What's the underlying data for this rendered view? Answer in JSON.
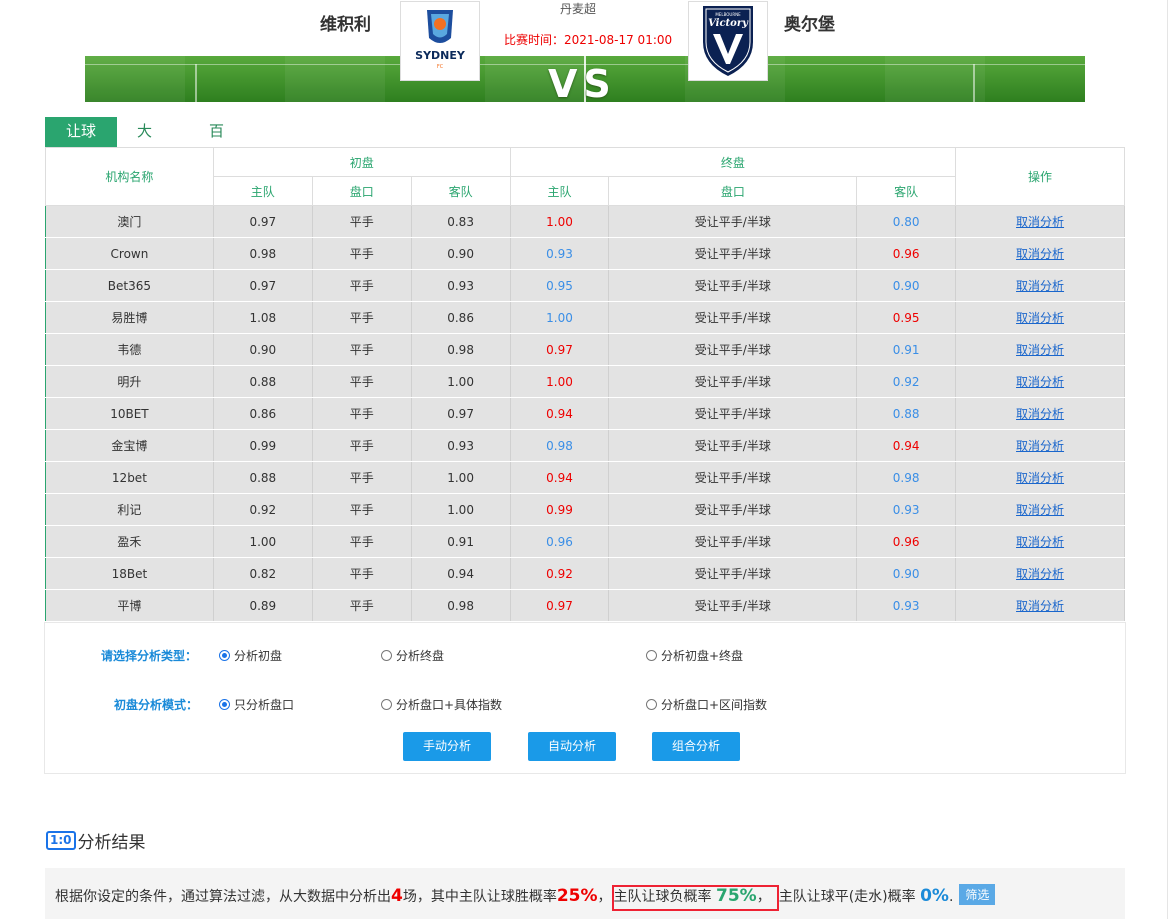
{
  "header": {
    "home_team": "维积利",
    "away_team": "奥尔堡",
    "league": "丹麦超",
    "match_time": "比赛时间：2021-08-17 01:00",
    "vs": "VS",
    "home_logo_text": "SYDNEY",
    "home_logo_sub": "FC",
    "away_logo_text": "Victory",
    "away_logo_sub": "MELBOURNE"
  },
  "tabs": [
    "让球",
    "大小",
    "百度探球者"
  ],
  "table": {
    "col_company": "机构名称",
    "group_initial": "初盘",
    "group_final": "终盘",
    "col_action": "操作",
    "sub_home": "主队",
    "sub_line": "盘口",
    "sub_away": "客队",
    "rows": [
      {
        "name": "澳门",
        "ih": "0.97",
        "il": "平手",
        "ia": "0.83",
        "fh": "1.00",
        "fh_c": "red",
        "fl": "受让平手/半球",
        "fa": "0.80",
        "fa_c": "blue",
        "action": "取消分析"
      },
      {
        "name": "Crown",
        "ih": "0.98",
        "il": "平手",
        "ia": "0.90",
        "fh": "0.93",
        "fh_c": "blue",
        "fl": "受让平手/半球",
        "fa": "0.96",
        "fa_c": "red",
        "action": "取消分析"
      },
      {
        "name": "Bet365",
        "ih": "0.97",
        "il": "平手",
        "ia": "0.93",
        "fh": "0.95",
        "fh_c": "blue",
        "fl": "受让平手/半球",
        "fa": "0.90",
        "fa_c": "blue",
        "action": "取消分析"
      },
      {
        "name": "易胜博",
        "ih": "1.08",
        "il": "平手",
        "ia": "0.86",
        "fh": "1.00",
        "fh_c": "blue",
        "fl": "受让平手/半球",
        "fa": "0.95",
        "fa_c": "red",
        "action": "取消分析"
      },
      {
        "name": "韦德",
        "ih": "0.90",
        "il": "平手",
        "ia": "0.98",
        "fh": "0.97",
        "fh_c": "red",
        "fl": "受让平手/半球",
        "fa": "0.91",
        "fa_c": "blue",
        "action": "取消分析"
      },
      {
        "name": "明升",
        "ih": "0.88",
        "il": "平手",
        "ia": "1.00",
        "fh": "1.00",
        "fh_c": "red",
        "fl": "受让平手/半球",
        "fa": "0.92",
        "fa_c": "blue",
        "action": "取消分析"
      },
      {
        "name": "10BET",
        "ih": "0.86",
        "il": "平手",
        "ia": "0.97",
        "fh": "0.94",
        "fh_c": "red",
        "fl": "受让平手/半球",
        "fa": "0.88",
        "fa_c": "blue",
        "action": "取消分析"
      },
      {
        "name": "金宝博",
        "ih": "0.99",
        "il": "平手",
        "ia": "0.93",
        "fh": "0.98",
        "fh_c": "blue",
        "fl": "受让平手/半球",
        "fa": "0.94",
        "fa_c": "red",
        "action": "取消分析"
      },
      {
        "name": "12bet",
        "ih": "0.88",
        "il": "平手",
        "ia": "1.00",
        "fh": "0.94",
        "fh_c": "red",
        "fl": "受让平手/半球",
        "fa": "0.98",
        "fa_c": "blue",
        "action": "取消分析"
      },
      {
        "name": "利记",
        "ih": "0.92",
        "il": "平手",
        "ia": "1.00",
        "fh": "0.99",
        "fh_c": "red",
        "fl": "受让平手/半球",
        "fa": "0.93",
        "fa_c": "blue",
        "action": "取消分析"
      },
      {
        "name": "盈禾",
        "ih": "1.00",
        "il": "平手",
        "ia": "0.91",
        "fh": "0.96",
        "fh_c": "blue",
        "fl": "受让平手/半球",
        "fa": "0.96",
        "fa_c": "red",
        "action": "取消分析"
      },
      {
        "name": "18Bet",
        "ih": "0.82",
        "il": "平手",
        "ia": "0.94",
        "fh": "0.92",
        "fh_c": "red",
        "fl": "受让平手/半球",
        "fa": "0.90",
        "fa_c": "blue",
        "action": "取消分析"
      },
      {
        "name": "平博",
        "ih": "0.89",
        "il": "平手",
        "ia": "0.98",
        "fh": "0.97",
        "fh_c": "red",
        "fl": "受让平手/半球",
        "fa": "0.93",
        "fa_c": "blue",
        "action": "取消分析"
      }
    ]
  },
  "panel": {
    "type_label": "请选择分析类型：",
    "type_options": [
      "分析初盘",
      "分析终盘",
      "分析初盘+终盘"
    ],
    "type_selected": 0,
    "mode_label": "初盘分析模式：",
    "mode_options": [
      "只分析盘口",
      "分析盘口+具体指数",
      "分析盘口+区间指数"
    ],
    "mode_selected": 0,
    "buttons": [
      "手动分析",
      "自动分析",
      "组合分析"
    ]
  },
  "result": {
    "icon": "1:0",
    "title": "分析结果",
    "p1": "根据你设定的条件，通过算法过滤，从大数据中分析出",
    "count": "4",
    "p2": "场，其中主队让球胜概率",
    "win": "25%",
    "p3": "，",
    "lose_label": "主队让球负概率",
    "lose": "75%",
    "p4": "，",
    "draw_label": "主队让球平(走水)概率",
    "draw": "0%",
    "p5": ".",
    "filter": "筛选"
  },
  "colors": {
    "accent": "#2aa56f",
    "red": "#ee0000",
    "blue": "#3a8ee6",
    "button": "#1a9ae8"
  }
}
